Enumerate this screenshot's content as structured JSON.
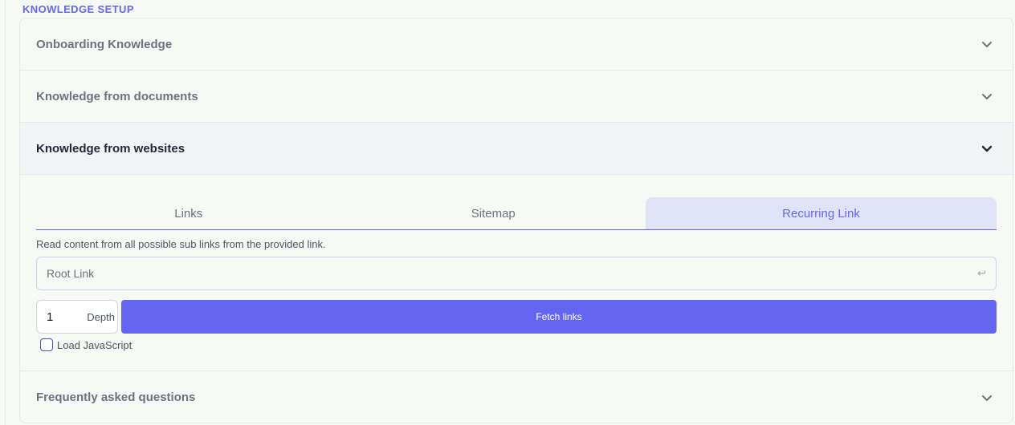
{
  "section_title": "KNOWLEDGE SETUP",
  "accordion": [
    {
      "label": "Onboarding Knowledge",
      "expanded": false
    },
    {
      "label": "Knowledge from documents",
      "expanded": false
    },
    {
      "label": "Knowledge from websites",
      "expanded": true
    },
    {
      "label": "Frequently asked questions",
      "expanded": false
    }
  ],
  "website_panel": {
    "tabs": [
      {
        "label": "Links",
        "active": false
      },
      {
        "label": "Sitemap",
        "active": false
      },
      {
        "label": "Recurring Link",
        "active": true
      }
    ],
    "description": "Read content from all possible sub links from the provided link.",
    "root_link": {
      "value": "",
      "placeholder": "Root Link",
      "enter_icon": "↩"
    },
    "depth": {
      "value": "1",
      "label": "Depth"
    },
    "fetch_button": "Fetch links",
    "load_js": {
      "label": "Load JavaScript",
      "checked": false
    }
  },
  "colors": {
    "accent": "#6366f1",
    "active_tab_bg": "#e0e2f6",
    "background": "#f7faf4"
  },
  "icons": {
    "chevron": "chevron-down-icon",
    "enter": "enter-key-icon"
  }
}
